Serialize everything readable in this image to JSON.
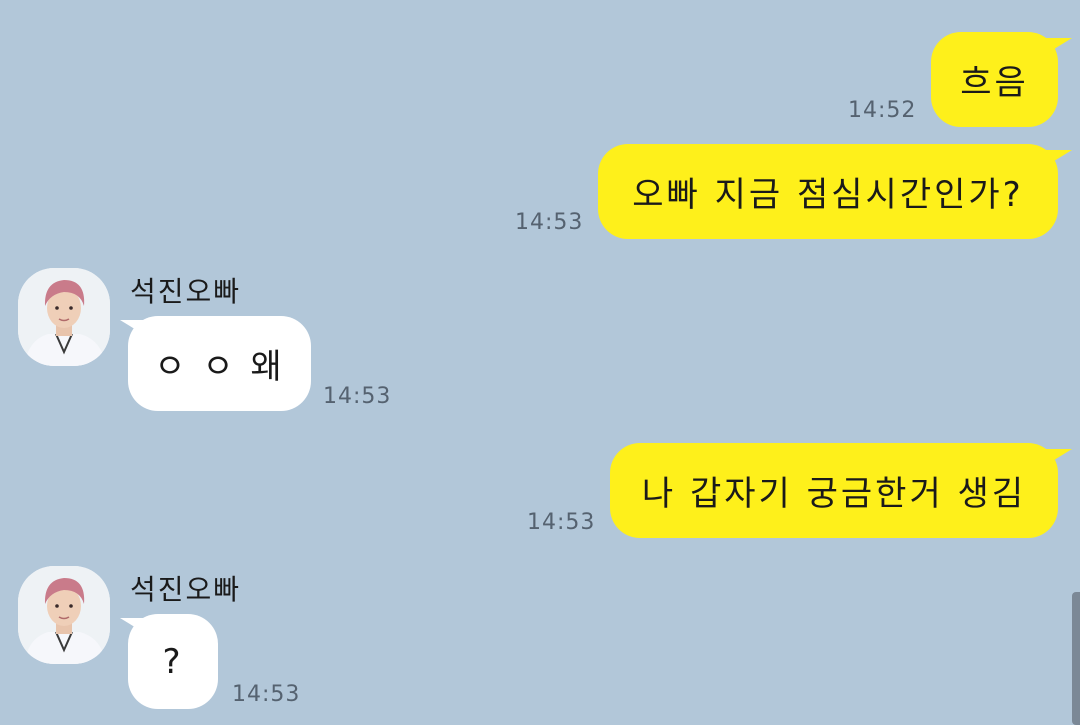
{
  "messages": [
    {
      "from": "me",
      "text": "흐음",
      "time": "14:52"
    },
    {
      "from": "me",
      "text": "오빠 지금 점심시간인가?",
      "time": "14:53"
    },
    {
      "from": "them",
      "sender": "석진오빠",
      "text": "ㅇ ㅇ 왜",
      "time": "14:53"
    },
    {
      "from": "me",
      "text": "나 갑자기 궁금한거 생김",
      "time": "14:53"
    },
    {
      "from": "them",
      "sender": "석진오빠",
      "text": "?",
      "time": "14:53"
    }
  ],
  "colors": {
    "background": "#b2c7d9",
    "my_bubble": "#fef01b",
    "their_bubble": "#ffffff",
    "time_text": "#556270"
  }
}
